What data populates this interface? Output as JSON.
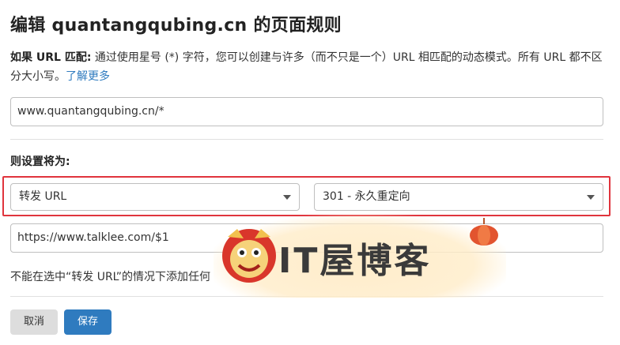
{
  "page": {
    "title": "编辑 quantangqubing.cn 的页面规则"
  },
  "description": {
    "lead": "如果 URL 匹配:",
    "body": "通过使用星号 (*) 字符，您可以创建与许多（而不只是一个）URL 相匹配的动态模式。所有 URL 都不区分大小写。",
    "link": "了解更多"
  },
  "url_pattern": {
    "value": "www.quantangqubing.cn/*"
  },
  "settings": {
    "label": "则设置将为:",
    "setting_select": "转发 URL",
    "status_select": "301 - 永久重定向",
    "destination": "https://www.talklee.com/$1",
    "note": "不能在选中“转发 URL”的情况下添加任何"
  },
  "buttons": {
    "cancel": "取消",
    "save": "保存"
  },
  "watermark": {
    "text": "IT屋博客"
  },
  "colors": {
    "accent": "#2f7bbf",
    "highlight": "#e0343d"
  }
}
